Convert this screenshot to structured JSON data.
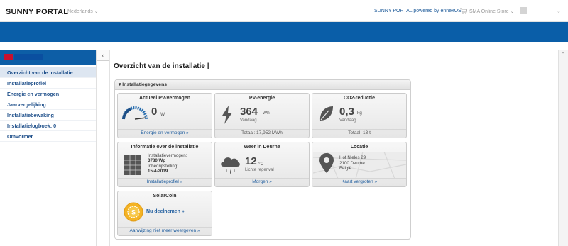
{
  "header": {
    "brand": "SUNNY PORTAL",
    "language": "Nederlands ⌄",
    "powered_by": "SUNNY PORTAL powered by ennexOS",
    "store": "SMA Online Store ⌄",
    "user_caret": "⌄"
  },
  "sidebar": {
    "items": [
      {
        "label": "Overzicht van de installatie",
        "active": true
      },
      {
        "label": "Installatieprofiel"
      },
      {
        "label": "Energie en vermogen"
      },
      {
        "label": "Jaarvergelijking"
      },
      {
        "label": "Installatiebewaking"
      },
      {
        "label": "Installatielogboek: 0"
      },
      {
        "label": "Omvormer"
      }
    ]
  },
  "controls": {
    "collapse": "‹",
    "scroll_up": "^"
  },
  "main": {
    "page_title": "Overzicht van de installatie |",
    "panel_title": "▾ Installatiegegevens",
    "tiles": {
      "pv_power": {
        "title": "Actueel PV-vermogen",
        "value": "0",
        "unit": "W",
        "link": "Energie en vermogen »",
        "gauge_fraction": 0
      },
      "pv_energy": {
        "title": "PV-energie",
        "value": "364",
        "unit": "Wh",
        "period": "Vandaag",
        "total": "Totaal: 17,952 MWh"
      },
      "co2": {
        "title": "CO2-reductie",
        "value": "0,3",
        "unit": "kg",
        "period": "Vandaag",
        "total": "Totaal: 13 t"
      },
      "installation": {
        "title": "Informatie over de installatie",
        "power_label": "Installatievermogen:",
        "power_value": "3780 Wp",
        "commissioning_label": "Inbedrijfstelling:",
        "commissioning_value": "15-4-2019",
        "link": "Installatieprofiel »"
      },
      "weather": {
        "title": "Weer in Deurne",
        "value": "12",
        "unit": "°C",
        "condition": "Lichte regenval",
        "link": "Morgen »"
      },
      "location": {
        "title": "Locatie",
        "line1": "Hof Nieles 29",
        "line2": "2100 Deurne",
        "line3": "België",
        "link": "Kaart vergroten »"
      },
      "solarcoin": {
        "title": "SolarCoin",
        "cta": "Nu deelnemen »",
        "link": "Aanwijzing niet meer weergeven »"
      }
    }
  },
  "colors": {
    "header_blue": "#0a5ea8",
    "link_blue": "#1f5d9e",
    "accent_red": "#c8102e"
  }
}
